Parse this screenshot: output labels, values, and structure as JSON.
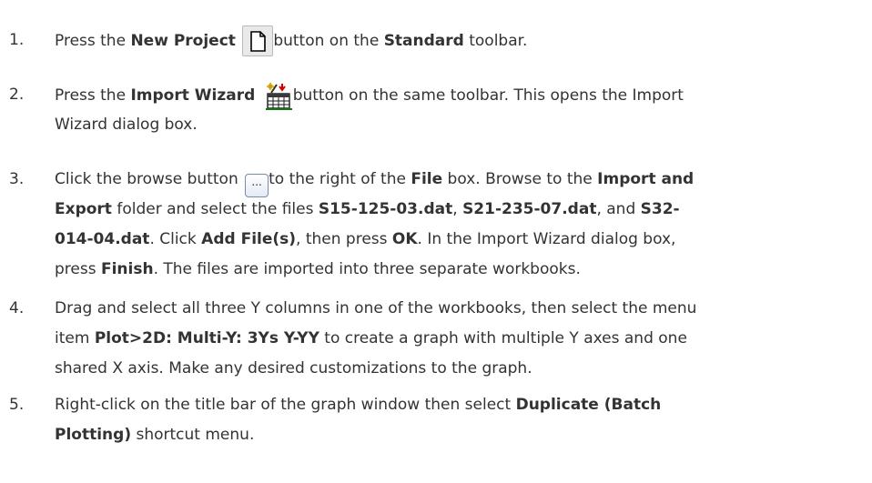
{
  "steps": [
    {
      "num": "1.",
      "lines": [
        [
          "Press the ",
          "New Project",
          " ",
          "button on the ",
          "Standard",
          " toolbar."
        ]
      ]
    },
    {
      "num": "2.",
      "lines": [
        [
          "Press the ",
          "Import Wizard",
          " ",
          "button on the same toolbar. This opens the Import"
        ],
        [
          "Wizard dialog box."
        ]
      ]
    },
    {
      "num": "3.",
      "icon_text": "...",
      "lines": [
        [
          "Click the browse button ",
          "to the right of the ",
          "File",
          " box. Browse to the ",
          "Import and"
        ],
        [
          "Export",
          " folder and select the files ",
          "S15-125-03.dat",
          ", ",
          "S21-235-07.dat",
          ", and ",
          "S32-"
        ],
        [
          "014-04.dat",
          ". Click ",
          "Add File(s)",
          ", then press ",
          "OK",
          ". In the Import Wizard dialog box,"
        ],
        [
          "press ",
          "Finish",
          ". The files are imported into three separate workbooks."
        ]
      ]
    },
    {
      "num": "4.",
      "lines": [
        [
          "Drag and select all three Y columns in one of the workbooks, then select the menu"
        ],
        [
          "item ",
          "Plot>2D: Multi-Y: 3Ys Y-YY",
          " to create a graph with multiple Y axes and one"
        ],
        [
          "shared X axis. Make any desired customizations to the graph."
        ]
      ]
    },
    {
      "num": "5.",
      "lines": [
        [
          "Right-click on the title bar of the graph window then select ",
          "Duplicate (Batch"
        ],
        [
          "Plotting)",
          " shortcut menu."
        ]
      ]
    }
  ],
  "icons": {
    "new_project": "new-project-icon",
    "import_wizard": "import-wizard-icon",
    "browse": "browse-button-icon"
  }
}
